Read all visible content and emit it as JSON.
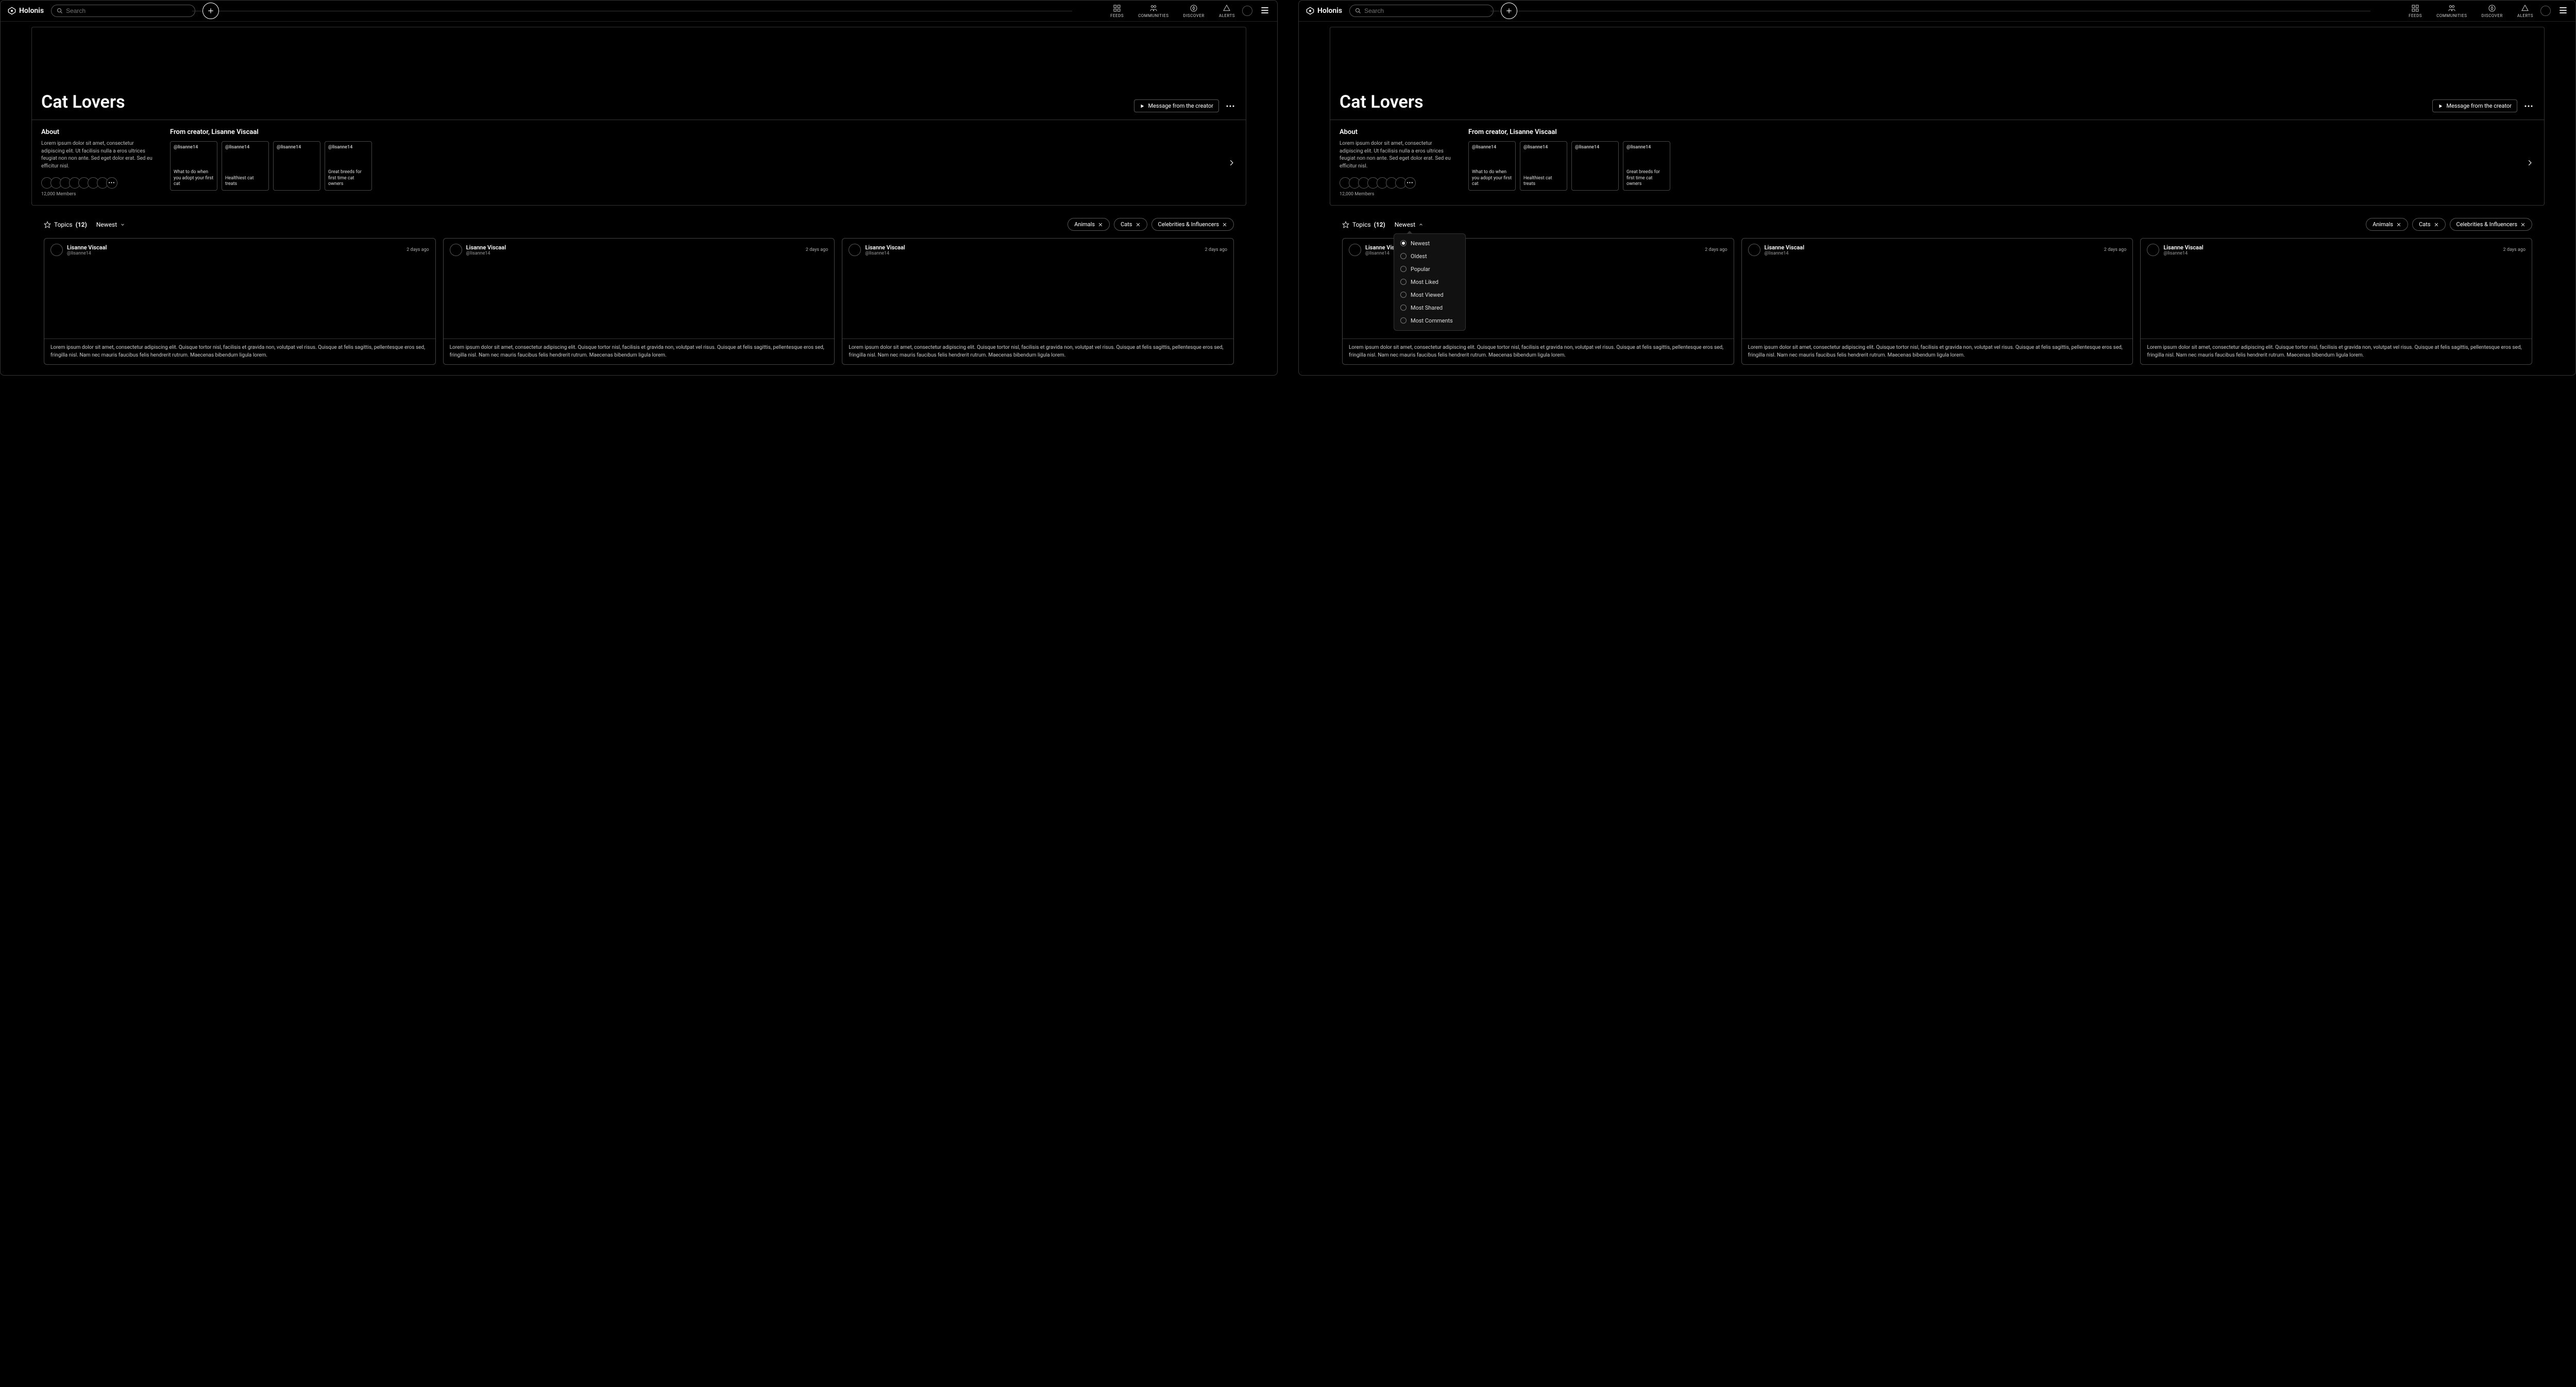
{
  "brand": "Holonis",
  "search": {
    "placeholder": "Search"
  },
  "nav": {
    "feeds": "FEEDS",
    "communities": "COMMUNITIES",
    "discover": "DISCOVER",
    "alerts": "ALERTS"
  },
  "hero": {
    "title": "Cat Lovers",
    "message_btn": "Message from the creator"
  },
  "about": {
    "heading": "About",
    "text": "Lorem ipsum dolor sit amet, consectetur adipiscing elit. Ut facilisis nulla a eros ultrices feugiat non non ante. Sed eget dolor erat. Sed eu efficitur nisl.",
    "members_count": "12,000 Members"
  },
  "creator": {
    "heading": "From creator, Lisanne Viscaal",
    "handle": "@lisanne14",
    "cards": [
      {
        "caption": "What to do when you adopt your first cat"
      },
      {
        "caption": "Healthiest cat treats"
      },
      {
        "caption": ""
      },
      {
        "caption": "Great breeds for first time cat owners"
      }
    ]
  },
  "topics": {
    "label": "Topics",
    "count": "(12)",
    "sort_label": "Newest",
    "chips": [
      "Animals",
      "Cats",
      "Celebrities & Influencers"
    ]
  },
  "sort_options": [
    "Newest",
    "Oldest",
    "Popular",
    "Most Liked",
    "Most Viewed",
    "Most Shared",
    "Most Comments"
  ],
  "post": {
    "author": "Lisanne Viscaal",
    "handle": "@lisanne14",
    "time": "2 days ago",
    "body": "Lorem ipsum dolor sit amet, consectetur adipiscing elit. Quisque tortor nisl, facilisis et gravida non, volutpat vel risus. Quisque at felis sagittis, pellentesque eros sed, fringilla nisl. Nam nec mauris faucibus felis hendrerit rutrum. Maecenas bibendum ligula lorem."
  }
}
